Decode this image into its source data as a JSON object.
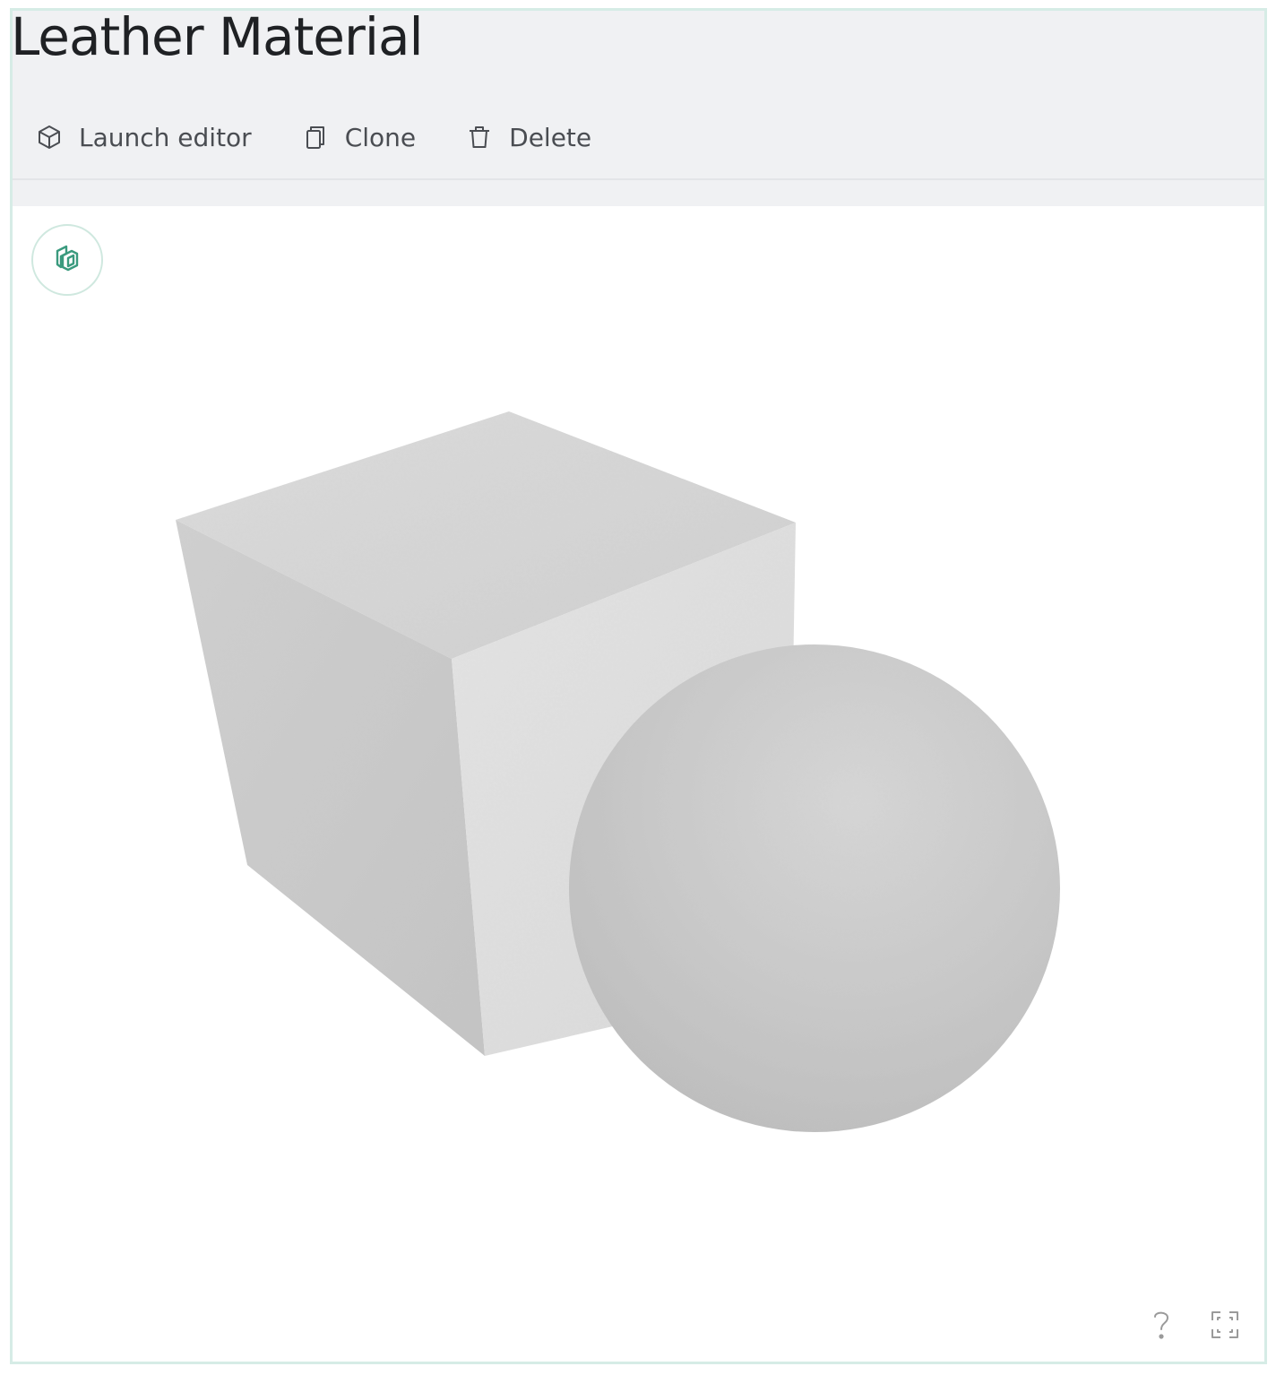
{
  "page": {
    "title": "Leather Material"
  },
  "toolbar": {
    "launch_editor_label": "Launch editor",
    "launch_editor_icon": "cube-icon",
    "clone_label": "Clone",
    "clone_icon": "copy-icon",
    "delete_label": "Delete",
    "delete_icon": "trash-icon"
  },
  "viewer": {
    "logo_icon": "sketchfab-logo-icon",
    "help_icon": "question-icon",
    "fullscreen_icon": "fullscreen-icon",
    "accent_color": "#3a9a7e"
  },
  "colors": {
    "header_bg": "#f0f1f3",
    "frame_border": "#d6ece6",
    "title_text": "#1f2124",
    "toolbar_text": "#4a4d52"
  }
}
